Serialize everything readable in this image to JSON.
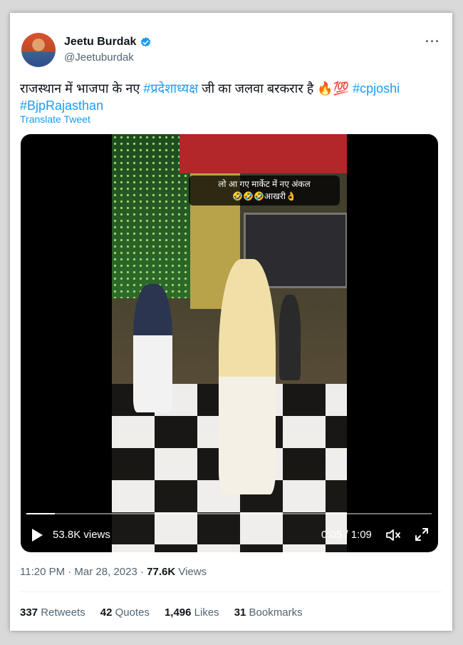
{
  "author": {
    "name": "Jeetu Burdak",
    "handle": "@Jeetuburdak"
  },
  "tweet": {
    "text_plain": "राजस्थान में भाजपा के नए ",
    "hashtag1": "#प्रदेशाध्यक्ष",
    "text_mid": " जी का जलवा बरकरार है 🔥💯 ",
    "hashtag2": "#cpjoshi",
    "hashtag3": "#BjpRajasthan",
    "translate_label": "Translate Tweet"
  },
  "video": {
    "caption_line1": "लो आ गए मार्केट में नए अंकल",
    "caption_line2": "🤣🤣🤣आखरी👌",
    "views": "53.8K views",
    "time": "0:05 / 1:09",
    "progress": 0.07
  },
  "meta": {
    "time": "11:20 PM · Mar 28, 2023 · ",
    "views_count": "77.6K",
    "views_label": " Views"
  },
  "stats": {
    "retweets_count": "337",
    "retweets_label": " Retweets",
    "quotes_count": "42",
    "quotes_label": " Quotes",
    "likes_count": "1,496",
    "likes_label": " Likes",
    "bookmarks_count": "31",
    "bookmarks_label": " Bookmarks"
  },
  "icons": {
    "verified": "verified-badge-icon",
    "more": "more-icon",
    "play": "play-icon",
    "mute": "mute-icon",
    "fullscreen": "fullscreen-icon"
  },
  "colors": {
    "accent": "#1d9bf0",
    "text": "#0f1419",
    "secondary": "#536471"
  }
}
